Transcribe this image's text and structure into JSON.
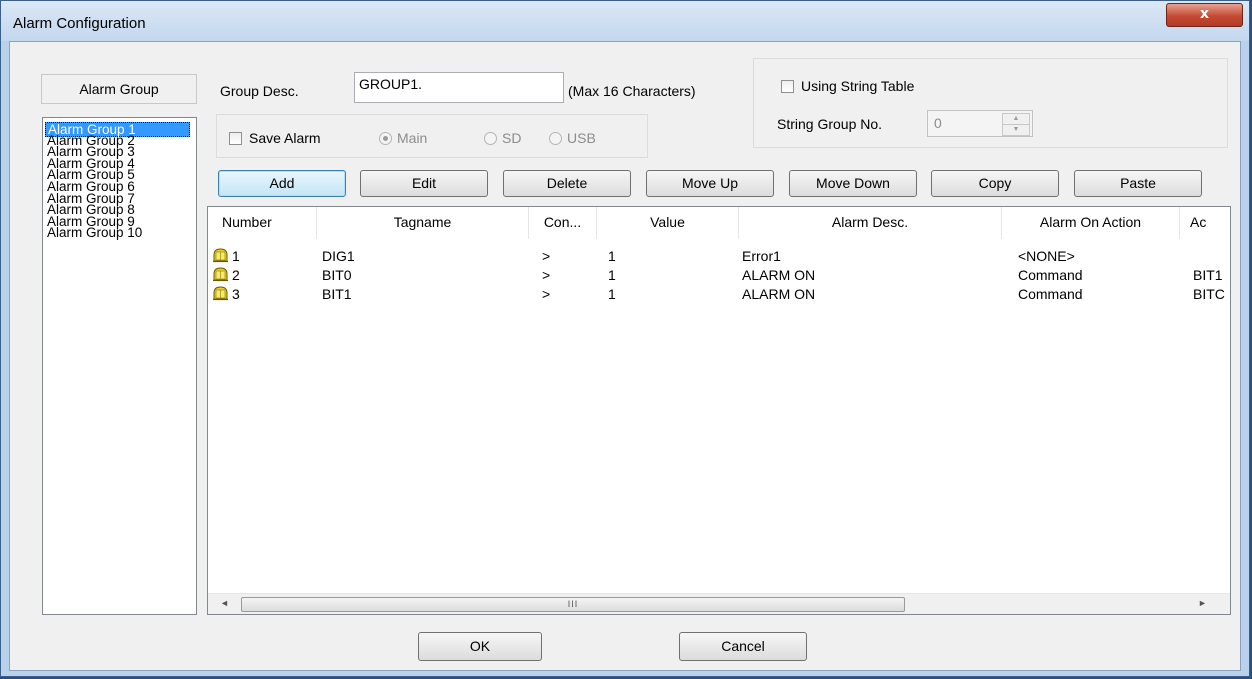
{
  "window": {
    "title": "Alarm Configuration",
    "close_glyph": "x",
    "frame_color": "#b9d1ea",
    "close_color": "#c44a32"
  },
  "alarm_group": {
    "heading": "Alarm Group",
    "items": [
      "Alarm Group 1",
      "Alarm Group 2",
      "Alarm Group 3",
      "Alarm Group 4",
      "Alarm Group 5",
      "Alarm Group 6",
      "Alarm Group 7",
      "Alarm Group 8",
      "Alarm Group 9",
      "Alarm Group 10"
    ],
    "selected": "Alarm Group 1",
    "selection_color": "#3399ff"
  },
  "group_desc": {
    "label": "Group Desc.",
    "value": "GROUP1.",
    "hint": "(Max 16 Characters)"
  },
  "save_alarm": {
    "label": "Save Alarm",
    "checked": false,
    "options": [
      "Main",
      "SD",
      "USB"
    ],
    "selected": "Main",
    "enabled": false
  },
  "string_table": {
    "checkbox_label": "Using String Table",
    "checked": false,
    "group_no_label": "String Group No.",
    "group_no_value": "0"
  },
  "toolbar": {
    "add": "Add",
    "edit": "Edit",
    "delete": "Delete",
    "move_up": "Move Up",
    "move_down": "Move Down",
    "copy": "Copy",
    "paste": "Paste"
  },
  "table": {
    "columns": [
      "Number",
      "Tagname",
      "Con...",
      "Value",
      "Alarm Desc.",
      "Alarm On Action",
      "Ac"
    ],
    "rows": [
      {
        "number": "1",
        "tagname": "DIG1",
        "condition": ">",
        "value": "1",
        "alarm_desc": "Error1",
        "on_action": "<NONE>",
        "action_more": ""
      },
      {
        "number": "2",
        "tagname": "BIT0",
        "condition": ">",
        "value": "1",
        "alarm_desc": "ALARM ON",
        "on_action": "Command",
        "action_more": "BIT1"
      },
      {
        "number": "3",
        "tagname": "BIT1",
        "condition": ">",
        "value": "1",
        "alarm_desc": "ALARM ON",
        "on_action": "Command",
        "action_more": "BITC"
      }
    ],
    "row_icon": "bell-alarm-icon",
    "icon_color": "#e8d020",
    "scroll_thumb_grip": "III",
    "scroll_left": "◄",
    "scroll_right": "►"
  },
  "footer": {
    "ok": "OK",
    "cancel": "Cancel"
  }
}
